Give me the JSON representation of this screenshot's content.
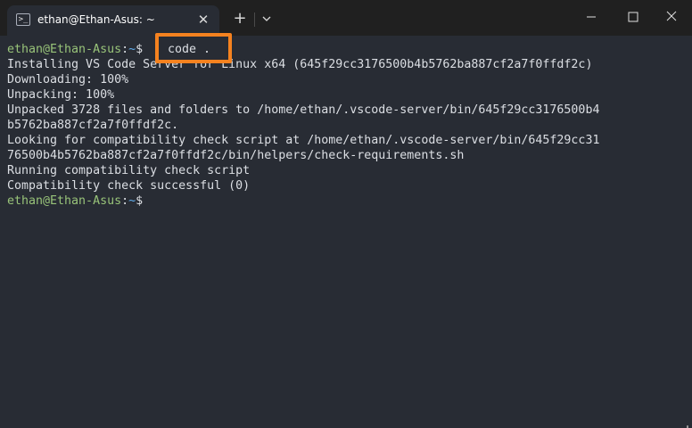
{
  "tab": {
    "title": "ethan@Ethan-Asus: ~",
    "icon": "powershell-icon",
    "close_glyph": "✕",
    "new_tab_glyph": "+"
  },
  "window_controls": {
    "minimize": "minimize-icon",
    "maximize": "maximize-icon",
    "close": "close-icon"
  },
  "terminal": {
    "prompt_user": "ethan@Ethan-Asus",
    "prompt_sep": ":",
    "prompt_path": "~",
    "prompt_dollar": "$",
    "command": "code .",
    "output": [
      "Installing VS Code Server for Linux x64 (645f29cc3176500b4b5762ba887cf2a7f0ffdf2c)",
      "Downloading: 100%",
      "Unpacking: 100%",
      "Unpacked 3728 files and folders to /home/ethan/.vscode-server/bin/645f29cc3176500b4",
      "b5762ba887cf2a7f0ffdf2c.",
      "Looking for compatibility check script at /home/ethan/.vscode-server/bin/645f29cc31",
      "76500b4b5762ba887cf2a7f0ffdf2c/bin/helpers/check-requirements.sh",
      "Running compatibility check script",
      "Compatibility check successful (0)"
    ]
  },
  "colors": {
    "highlight_box": "#f5821f",
    "prompt_user": "#98c379",
    "prompt_path": "#61afef",
    "background": "#282c34"
  }
}
